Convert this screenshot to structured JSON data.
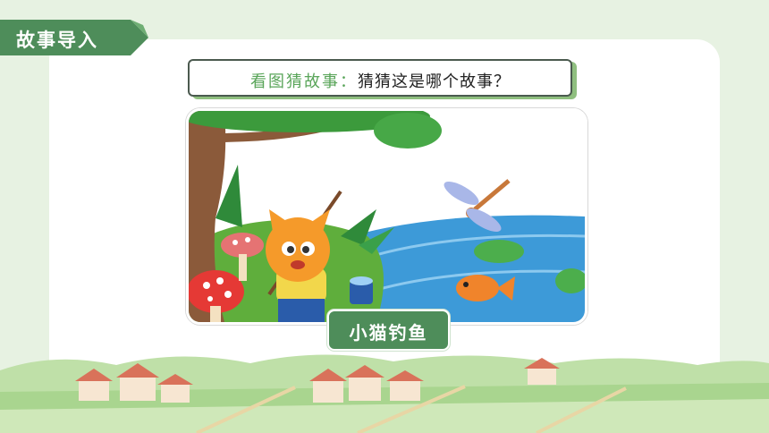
{
  "section_tab": {
    "label": "故事导入"
  },
  "prompt": {
    "label": "看图猜故事：",
    "question": "猜猜这是哪个故事？"
  },
  "illustration": {
    "subject": "cat-fishing-scene"
  },
  "answer": {
    "label": "小猫钓鱼"
  },
  "colors": {
    "primary_green": "#4e8d5a",
    "accent_green": "#5aa55a",
    "background": "#e7f2e2"
  }
}
